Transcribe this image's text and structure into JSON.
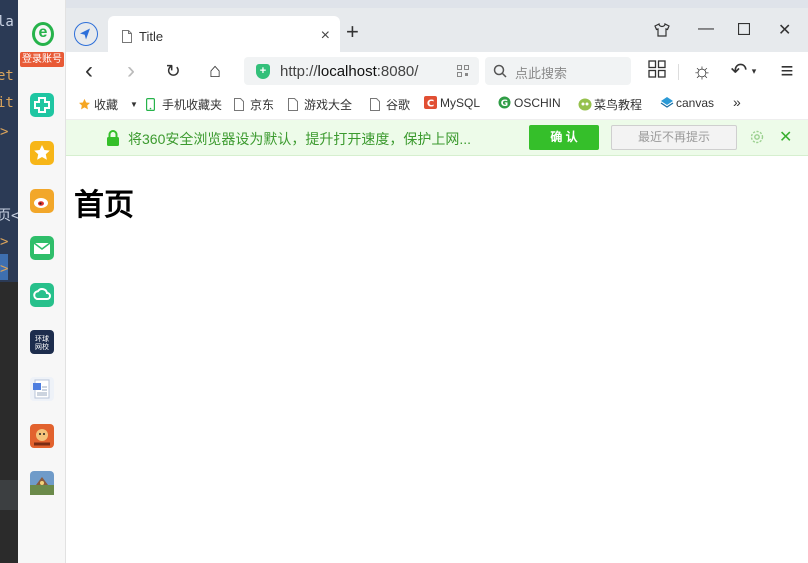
{
  "editor_fragments": [
    {
      "text": "la",
      "color": "light"
    },
    {
      "text": "et",
      "color": "orange"
    },
    {
      "text": "it",
      "color": "orange"
    },
    {
      "text": ">",
      "color": "orange"
    },
    {
      "text": "页<",
      "color": "light"
    },
    {
      "text": ">",
      "color": "orange"
    },
    {
      "text": ">",
      "color": "orange"
    }
  ],
  "sidebar": {
    "logo_badge": "登录账号",
    "icons": [
      {
        "name": "health-plus-icon",
        "color": "#1fc6a2"
      },
      {
        "name": "favorites-star-icon",
        "color": "#f7b618"
      },
      {
        "name": "weibo-icon",
        "color": "#f2a72a"
      },
      {
        "name": "mail-icon",
        "color": "#2fbe6a"
      },
      {
        "name": "cloud-drive-icon",
        "color": "#27c08b"
      },
      {
        "name": "news-icon",
        "color": "#1d2d4d"
      },
      {
        "name": "document-icon",
        "color": "#4e7ee0"
      },
      {
        "name": "game-icon",
        "color": "#e2622e"
      },
      {
        "name": "game-icon-2",
        "color": "#6f9bc9"
      }
    ]
  },
  "tab": {
    "title": "Title",
    "close_glyph": "×",
    "new_tab_glyph": "+"
  },
  "window_controls": {
    "skin_glyph": "👕",
    "minimize_glyph": "—",
    "maximize_glyph": "☐",
    "close_glyph": "✕"
  },
  "toolbar": {
    "back_glyph": "‹",
    "forward_glyph": "›",
    "reload_glyph": "↻",
    "home_glyph": "⌂",
    "url_prefix": "http://",
    "url_host": "localhost",
    "url_rest": ":8080/",
    "search_placeholder": "点此搜索",
    "apps_glyph": "⊞",
    "brightness_glyph": "☼",
    "undo_glyph": "↶",
    "menu_glyph": "≡"
  },
  "bookmarks": [
    {
      "label": "收藏",
      "name": "bookmark-favorites"
    },
    {
      "label": "手机收藏夹",
      "name": "bookmark-mobile"
    },
    {
      "label": "京东",
      "name": "bookmark-jd"
    },
    {
      "label": "游戏大全",
      "name": "bookmark-games"
    },
    {
      "label": "谷歌",
      "name": "bookmark-google"
    },
    {
      "label": "MySQL",
      "name": "bookmark-mysql"
    },
    {
      "label": "OSCHIN",
      "name": "bookmark-oschina"
    },
    {
      "label": "菜鸟教程",
      "name": "bookmark-runoob"
    },
    {
      "label": "canvas",
      "name": "bookmark-canvas"
    }
  ],
  "bookmarks_more": "»",
  "notice": {
    "text": "将360安全浏览器设为默认，提升打开速度，保护上网...",
    "confirm_label": "确 认",
    "later_label": "最近不再提示",
    "close_glyph": "✕"
  },
  "page": {
    "heading": "首页"
  },
  "colors": {
    "accent_blue": "#2d6fd9",
    "notice_green": "#3b9a2e",
    "confirm_green": "#35bf2a",
    "shield_green": "#33c07a"
  }
}
